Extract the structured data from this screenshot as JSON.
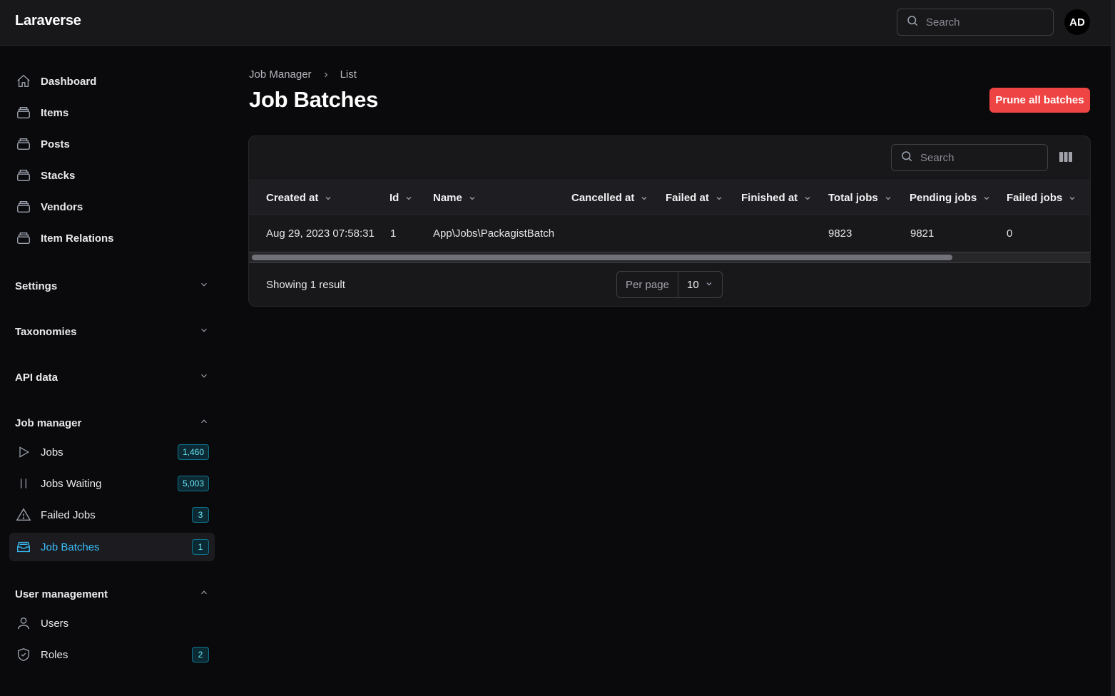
{
  "app": {
    "brand": "Laraverse",
    "avatar_initials": "AD"
  },
  "top_search": {
    "placeholder": "Search"
  },
  "sidebar": {
    "items": [
      {
        "label": "Dashboard"
      },
      {
        "label": "Items"
      },
      {
        "label": "Posts"
      },
      {
        "label": "Stacks"
      },
      {
        "label": "Vendors"
      },
      {
        "label": "Item Relations"
      }
    ],
    "groups": {
      "settings": "Settings",
      "taxonomies": "Taxonomies",
      "api_data": "API data",
      "job_manager": "Job manager",
      "user_management": "User management"
    },
    "job_manager_items": [
      {
        "label": "Jobs",
        "badge": "1,460"
      },
      {
        "label": "Jobs Waiting",
        "badge": "5,003"
      },
      {
        "label": "Failed Jobs",
        "badge": "3"
      },
      {
        "label": "Job Batches",
        "badge": "1"
      }
    ],
    "user_items": [
      {
        "label": "Users"
      },
      {
        "label": "Roles",
        "badge": "2"
      }
    ],
    "accent_color": "#38bdf8"
  },
  "breadcrumb": {
    "parent": "Job Manager",
    "current": "List"
  },
  "page": {
    "title": "Job Batches",
    "prune_label": "Prune all batches",
    "danger_color": "#ef4444"
  },
  "table": {
    "search_placeholder": "Search",
    "columns": [
      "Created at",
      "Id",
      "Name",
      "Cancelled at",
      "Failed at",
      "Finished at",
      "Total jobs",
      "Pending jobs",
      "Failed jobs"
    ],
    "rows": [
      [
        "Aug 29, 2023 07:58:31",
        "1",
        "App\\Jobs\\PackagistBatch",
        "",
        "",
        "",
        "9823",
        "9821",
        "0"
      ]
    ],
    "result_text": "Showing 1 result",
    "per_page_label": "Per page",
    "per_page_value": "10"
  }
}
